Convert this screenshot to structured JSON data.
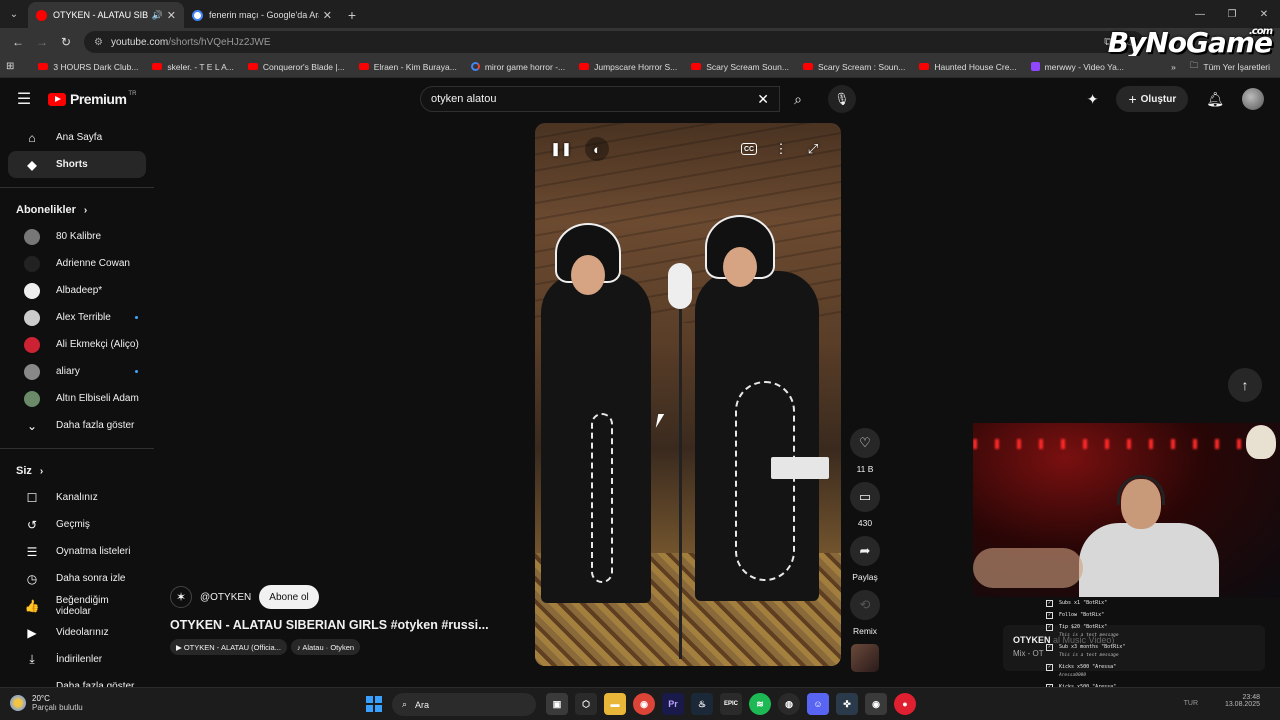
{
  "browser": {
    "tabs": [
      {
        "title": "OTYKEN - ALATAU SIBERIAN",
        "active": true,
        "favicon_color": "#ff0000"
      },
      {
        "title": "fenerin maçı - Google'da Ara",
        "active": false,
        "favicon_color": "#4285f4"
      }
    ],
    "url_host": "youtube.com",
    "url_path": "/shorts/hVQeHJz2JWE",
    "bookmarks": [
      {
        "label": "3 HOURS Dark Club...",
        "kind": "yt"
      },
      {
        "label": "skeler. - T E L A...",
        "kind": "yt"
      },
      {
        "label": "Conqueror's Blade |...",
        "kind": "yt"
      },
      {
        "label": "Elraen - Kim Buraya...",
        "kind": "yt"
      },
      {
        "label": "miror game horror -...",
        "kind": "g"
      },
      {
        "label": "Jumpscare Horror S...",
        "kind": "yt"
      },
      {
        "label": "Scary Scream Soun...",
        "kind": "yt"
      },
      {
        "label": "Scary Scream : Soun...",
        "kind": "yt"
      },
      {
        "label": "Haunted House Cre...",
        "kind": "yt"
      },
      {
        "label": "merwwy - Video Ya...",
        "kind": "tw"
      }
    ],
    "bookmarks_all": "Tüm Yer İşaretleri"
  },
  "overlay_logo": {
    "main": "ByNoGame",
    "suffix": ".com"
  },
  "youtube": {
    "logo_word": "Premium",
    "logo_region": "TR",
    "search_value": "otyken alatou",
    "create_label": "Oluştur"
  },
  "sidebar": {
    "top": [
      {
        "label": "Ana Sayfa",
        "icon": "home-icon",
        "glyph": "⌂",
        "active": false
      },
      {
        "label": "Shorts",
        "icon": "shorts-icon",
        "glyph": "◆",
        "active": true
      }
    ],
    "subs_header": "Abonelikler",
    "subs": [
      {
        "label": "80 Kalibre",
        "color": "#777777",
        "dot": false
      },
      {
        "label": "Adrienne Cowan",
        "color": "#222222",
        "dot": false
      },
      {
        "label": "Albadeep*",
        "color": "#eeeeee",
        "dot": false
      },
      {
        "label": "Alex Terrible",
        "color": "#cccccc",
        "dot": true
      },
      {
        "label": "Ali Ekmekçi (Aliço)",
        "color": "#cc2233",
        "dot": false
      },
      {
        "label": "aliary",
        "color": "#888888",
        "dot": true
      },
      {
        "label": "Altın Elbiseli Adam",
        "color": "#6a8a6a",
        "dot": false
      }
    ],
    "subs_more": "Daha fazla göster",
    "you_header": "Siz",
    "you": [
      {
        "label": "Kanalınız",
        "icon": "channel-icon",
        "glyph": "☐"
      },
      {
        "label": "Geçmiş",
        "icon": "history-icon",
        "glyph": "↺"
      },
      {
        "label": "Oynatma listeleri",
        "icon": "playlists-icon",
        "glyph": "☰"
      },
      {
        "label": "Daha sonra izle",
        "icon": "watch-later-icon",
        "glyph": "◷"
      },
      {
        "label": "Beğendiğim videolar",
        "icon": "liked-icon",
        "glyph": "👍"
      },
      {
        "label": "Videolarınız",
        "icon": "your-videos-icon",
        "glyph": "▶"
      },
      {
        "label": "İndirilenler",
        "icon": "downloads-icon",
        "glyph": "⤓"
      }
    ],
    "you_more": "Daha fazla göster"
  },
  "short": {
    "channel": "@OTYKEN",
    "subscribe": "Abone ol",
    "title": "OTYKEN - ALATAU SIBERIAN GIRLS #otyken #russi...",
    "chips": [
      "▶ OTYKEN - ALATAU (Officia...",
      "♪ Alatau · Otyken"
    ],
    "actions": {
      "likes": "11 B",
      "comments": "430",
      "share": "Paylaş",
      "remix": "Remix"
    }
  },
  "alerts": [
    {
      "text": "Subs x1 \"BotRix\"",
      "note": ""
    },
    {
      "text": "Follow \"BotRix\"",
      "note": ""
    },
    {
      "text": "Tip $20 \"BotRix\"",
      "note": "This is a test message"
    },
    {
      "text": "Sub x3 months \"BotRix\"",
      "note": "This is a test message"
    },
    {
      "text": "Kicks x500 \"Aressa\"",
      "note": "Aressa0000"
    },
    {
      "text": "Kicks x500 \"Aressa\"",
      "note": ""
    }
  ],
  "miniplayer": {
    "title": "OTYKEN",
    "title_faded": "al Music Video)",
    "sub": "Mix - OT"
  },
  "taskbar": {
    "temp": "20°C",
    "weather": "Parçalı bulutlu",
    "search": "Ara",
    "lang": "TUR",
    "time": "23:48",
    "date": "13.08.2025"
  }
}
